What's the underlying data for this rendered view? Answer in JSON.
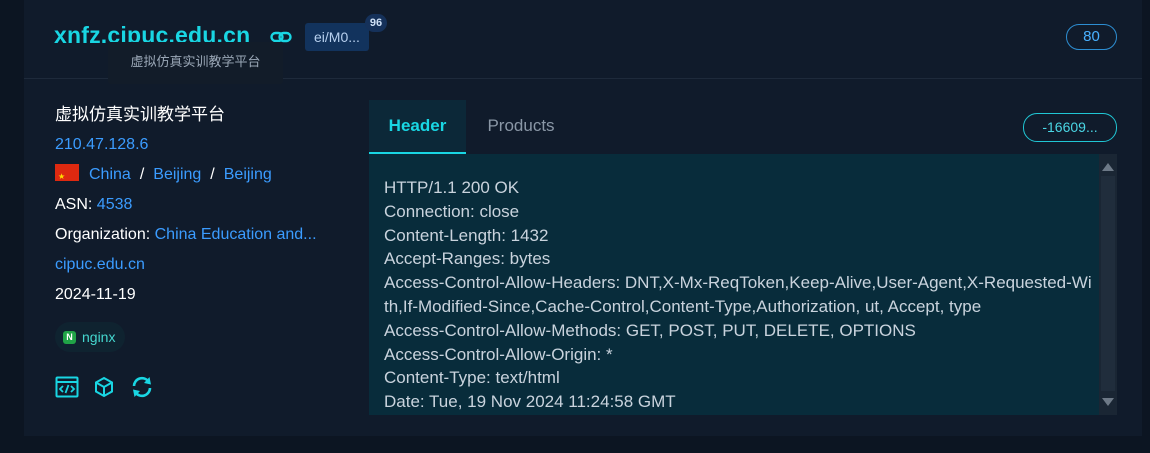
{
  "header": {
    "host": "xnfz.cipuc.edu.cn",
    "tag_label": "ei/M0...",
    "tag_count": "96",
    "tooltip": "虚拟仿真实训教学平台",
    "port": "80"
  },
  "info": {
    "title": "虚拟仿真实训教学平台",
    "ip": "210.47.128.6",
    "country": "China",
    "region": "Beijing",
    "city": "Beijing",
    "separator": "/",
    "asn_label": "ASN:",
    "asn_value": "4538",
    "org_label": "Organization:",
    "org_value": "China Education and...",
    "domain": "cipuc.edu.cn",
    "date": "2024-11-19",
    "tech_tag": "nginx",
    "tech_logo_letter": "N"
  },
  "tabs": {
    "header": "Header",
    "products": "Products",
    "hash": "-16609..."
  },
  "banner": {
    "text": "HTTP/1.1 200 OK\nConnection: close\nContent-Length: 1432\nAccept-Ranges: bytes\nAccess-Control-Allow-Headers: DNT,X-Mx-ReqToken,Keep-Alive,User-Agent,X-Requested-With,If-Modified-Since,Cache-Control,Content-Type,Authorization, ut, Accept, type\nAccess-Control-Allow-Methods: GET, POST, PUT, DELETE, OPTIONS\nAccess-Control-Allow-Origin: *\nContent-Type: text/html\nDate: Tue, 19 Nov 2024 11:24:58 GMT"
  },
  "icons": {
    "link": "link-icon",
    "flag": "china-flag-icon",
    "code": "code-icon",
    "cube": "cube-icon",
    "refresh": "refresh-icon"
  },
  "colors": {
    "accent_cyan": "#19d6e3",
    "link_blue": "#3b9cff",
    "card_bg": "#101b2b",
    "banner_bg": "#082c3b"
  }
}
